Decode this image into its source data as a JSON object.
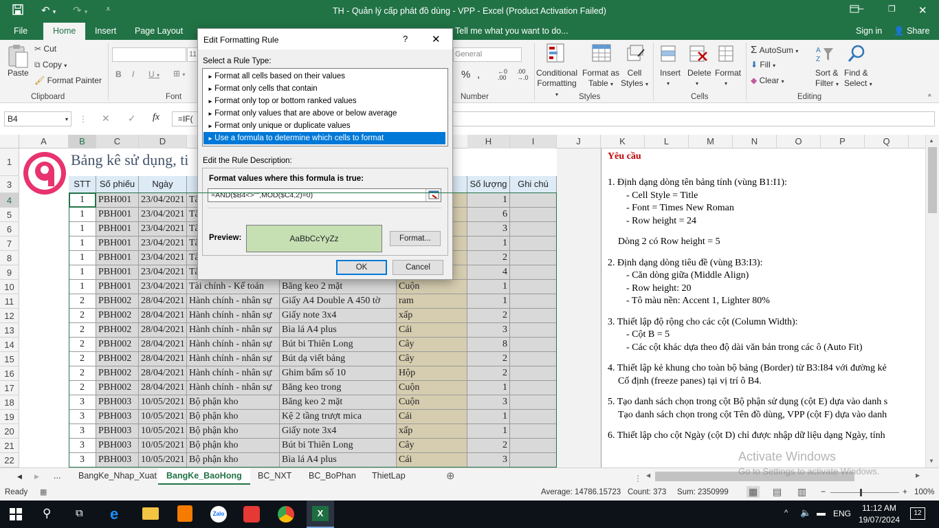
{
  "window": {
    "title": "TH - Quản lý cấp phát đồ dùng - VPP - Excel (Product Activation Failed)",
    "signin": "Sign in",
    "share": "Share",
    "tell_me": "Tell me what you want to do..."
  },
  "tabs": [
    "File",
    "Home",
    "Insert",
    "Page Layout"
  ],
  "ribbon": {
    "clipboard": {
      "paste": "Paste",
      "cut": "Cut",
      "copy": "Copy",
      "format_painter": "Format Painter",
      "label": "Clipboard"
    },
    "font": {
      "label": "Font",
      "size": "11"
    },
    "number": {
      "label": "Number",
      "format": "General"
    },
    "styles": {
      "conditional": "Conditional",
      "formatting": "Formatting",
      "format_as": "Format as",
      "table": "Table",
      "cell": "Cell",
      "styles": "Styles",
      "label": "Styles"
    },
    "cells": {
      "insert": "Insert",
      "delete": "Delete",
      "format": "Format",
      "label": "Cells"
    },
    "editing": {
      "autosum": "AutoSum",
      "fill": "Fill",
      "clear": "Clear",
      "sort": "Sort &",
      "filter": "Filter",
      "find": "Find &",
      "select": "Select",
      "label": "Editing"
    }
  },
  "formula_bar": {
    "name_box": "B4",
    "formula": "=IF("
  },
  "columns": [
    "A",
    "B",
    "C",
    "D",
    "H",
    "I",
    "J",
    "K",
    "L",
    "M",
    "N",
    "O",
    "P",
    "Q"
  ],
  "sheet": {
    "title": "Bảng kê sử dụng, ti",
    "headers": {
      "stt": "STT",
      "so_phieu": "Số phiếu",
      "ngay": "Ngày",
      "so_luong": "Số lượng",
      "ghi_chu": "Ghi chú"
    },
    "rows": [
      {
        "r": "4",
        "stt": "1",
        "sp": "PBH001",
        "ngay": "23/04/2021",
        "bp": "Tà",
        "dd": "",
        "dvt": "",
        "sl": "1"
      },
      {
        "r": "5",
        "stt": "1",
        "sp": "PBH001",
        "ngay": "23/04/2021",
        "bp": "Tà",
        "dd": "",
        "dvt": "",
        "sl": "6"
      },
      {
        "r": "6",
        "stt": "1",
        "sp": "PBH001",
        "ngay": "23/04/2021",
        "bp": "Tà",
        "dd": "",
        "dvt": "",
        "sl": "3"
      },
      {
        "r": "7",
        "stt": "1",
        "sp": "PBH001",
        "ngay": "23/04/2021",
        "bp": "Tà",
        "dd": "",
        "dvt": "",
        "sl": "1"
      },
      {
        "r": "8",
        "stt": "1",
        "sp": "PBH001",
        "ngay": "23/04/2021",
        "bp": "Tà",
        "dd": "",
        "dvt": "",
        "sl": "2"
      },
      {
        "r": "9",
        "stt": "1",
        "sp": "PBH001",
        "ngay": "23/04/2021",
        "bp": "Tà",
        "dd": "",
        "dvt": "",
        "sl": "4"
      },
      {
        "r": "10",
        "stt": "1",
        "sp": "PBH001",
        "ngay": "23/04/2021",
        "bp": "Tài chính - Kế toán",
        "dd": "Băng keo 2 mặt",
        "dvt": "Cuộn",
        "sl": "1"
      },
      {
        "r": "11",
        "stt": "2",
        "sp": "PBH002",
        "ngay": "28/04/2021",
        "bp": "Hành chính - nhân sự",
        "dd": "Giấy A4 Double A 450 tờ",
        "dvt": "ram",
        "sl": "1"
      },
      {
        "r": "12",
        "stt": "2",
        "sp": "PBH002",
        "ngay": "28/04/2021",
        "bp": "Hành chính - nhân sự",
        "dd": "Giấy note 3x4",
        "dvt": "xấp",
        "sl": "2"
      },
      {
        "r": "13",
        "stt": "2",
        "sp": "PBH002",
        "ngay": "28/04/2021",
        "bp": "Hành chính - nhân sự",
        "dd": "Bìa lá A4 plus",
        "dvt": "Cái",
        "sl": "3"
      },
      {
        "r": "14",
        "stt": "2",
        "sp": "PBH002",
        "ngay": "28/04/2021",
        "bp": "Hành chính - nhân sự",
        "dd": "Bút bi Thiên Long",
        "dvt": "Cây",
        "sl": "8"
      },
      {
        "r": "15",
        "stt": "2",
        "sp": "PBH002",
        "ngay": "28/04/2021",
        "bp": "Hành chính - nhân sự",
        "dd": "Bút dạ viết bảng",
        "dvt": "Cây",
        "sl": "2"
      },
      {
        "r": "16",
        "stt": "2",
        "sp": "PBH002",
        "ngay": "28/04/2021",
        "bp": "Hành chính - nhân sự",
        "dd": "Ghim bấm số 10",
        "dvt": "Hộp",
        "sl": "2"
      },
      {
        "r": "17",
        "stt": "2",
        "sp": "PBH002",
        "ngay": "28/04/2021",
        "bp": "Hành chính - nhân sự",
        "dd": "Băng keo trong",
        "dvt": "Cuộn",
        "sl": "1"
      },
      {
        "r": "18",
        "stt": "3",
        "sp": "PBH003",
        "ngay": "10/05/2021",
        "bp": "Bộ phận kho",
        "dd": "Băng keo 2 mặt",
        "dvt": "Cuộn",
        "sl": "3"
      },
      {
        "r": "19",
        "stt": "3",
        "sp": "PBH003",
        "ngay": "10/05/2021",
        "bp": "Bộ phận kho",
        "dd": "Kệ 2 tầng trượt mica",
        "dvt": "Cái",
        "sl": "1"
      },
      {
        "r": "20",
        "stt": "3",
        "sp": "PBH003",
        "ngay": "10/05/2021",
        "bp": "Bộ phận kho",
        "dd": "Giấy note 3x4",
        "dvt": "xấp",
        "sl": "1"
      },
      {
        "r": "21",
        "stt": "3",
        "sp": "PBH003",
        "ngay": "10/05/2021",
        "bp": "Bộ phận kho",
        "dd": "Bút bi Thiên Long",
        "dvt": "Cây",
        "sl": "2"
      },
      {
        "r": "22",
        "stt": "3",
        "sp": "PBH003",
        "ngay": "10/05/2021",
        "bp": "Bộ phận kho",
        "dd": "Bìa lá A4 plus",
        "dvt": "Cái",
        "sl": "3"
      }
    ]
  },
  "requirements": [
    {
      "text": "Yêu cầu",
      "bold": true
    },
    {
      "text": "1. Định dạng dòng tên bảng tính (vùng B1:I1):"
    },
    {
      "text": "- Cell Style = Title",
      "indent": true
    },
    {
      "text": "- Font = Times New Roman",
      "indent": true
    },
    {
      "text": "- Row height = 24",
      "indent": true
    },
    {
      "text": "Dòng 2 có Row height = 5",
      "half": true
    },
    {
      "text": "2. Định dạng dòng tiêu đề (vùng B3:I3):"
    },
    {
      "text": "- Căn dòng giữa (Middle Align)",
      "indent": true
    },
    {
      "text": "- Row height: 20",
      "indent": true
    },
    {
      "text": "- Tô màu nền: Accent 1, Lighter 80%",
      "indent": true
    },
    {
      "text": "3. Thiết lập độ rộng cho các cột (Column Width):"
    },
    {
      "text": "- Cột B = 5",
      "indent": true
    },
    {
      "text": "- Các cột khác dựa theo độ dài văn bản trong các ô (Auto Fit)",
      "indent": true
    },
    {
      "text": "4. Thiết lập kẻ khung cho toàn bộ bảng (Border) từ B3:I84 với đường kẻ"
    },
    {
      "text": "Cố định (freeze panes) tại vị trí ô B4.",
      "half": true
    },
    {
      "text": "5. Tạo danh sách chọn trong cột Bộ phận sử dụng (cột E) dựa vào danh s"
    },
    {
      "text": "Tạo danh sách chọn trong cột Tên đồ dùng, VPP (cột F) dựa vào danh",
      "half": true
    },
    {
      "text": "6. Thiết lập cho cột Ngày (cột D) chỉ được nhập dữ liệu dạng Ngày, tính"
    }
  ],
  "dialog": {
    "title": "Edit Formatting Rule",
    "help": "?",
    "select_type": "Select a Rule Type:",
    "rules": [
      "Format all cells based on their values",
      "Format only cells that contain",
      "Format only top or bottom ranked values",
      "Format only values that are above or below average",
      "Format only unique or duplicate values",
      "Use a formula to determine which cells to format"
    ],
    "selected_index": 5,
    "edit_desc": "Edit the Rule Description:",
    "formula_label": "Format values where this formula is true:",
    "formula": "=AND($B4<>\"\",MOD($C4,2)=0)",
    "preview_label": "Preview:",
    "preview_text": "AaBbCcYyZz",
    "preview_color": "#c6e0b4",
    "format_btn": "Format...",
    "ok": "OK",
    "cancel": "Cancel"
  },
  "sheet_tabs": [
    "...",
    "BangKe_Nhap_Xuat",
    "BangKe_BaoHong",
    "BC_NXT",
    "BC_BoPhan",
    "ThietLap"
  ],
  "active_sheet": "BangKe_BaoHong",
  "status": {
    "ready": "Ready",
    "average": "Average: 14786.15723",
    "count": "Count: 373",
    "sum": "Sum: 2350999",
    "zoom": "100%"
  },
  "watermark": {
    "line1": "Activate Windows",
    "line2": "Go to Settings to activate Windows."
  },
  "taskbar": {
    "lang": "ENG",
    "time": "11:12 AM",
    "date": "19/07/2024",
    "notif": "12"
  }
}
